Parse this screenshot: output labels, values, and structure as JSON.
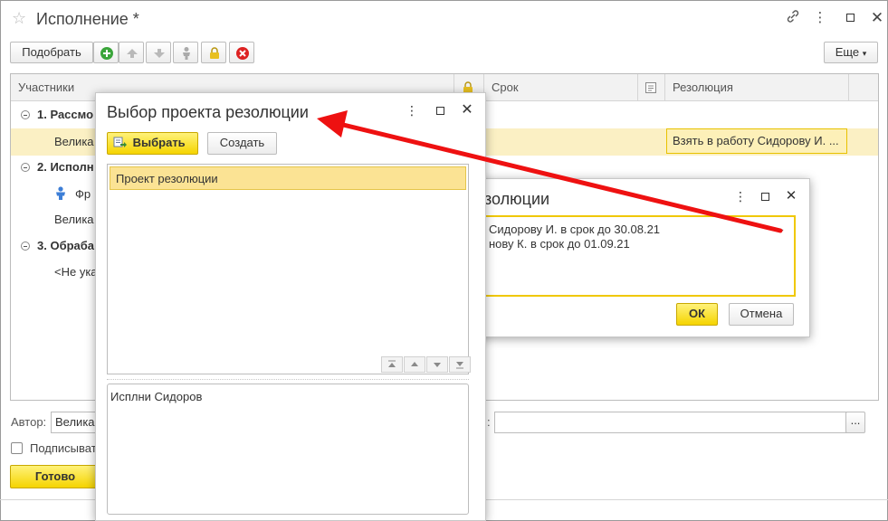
{
  "window": {
    "title": "Исполнение *"
  },
  "toolbar": {
    "pick_label": "Подобрать",
    "more_label": "Еще"
  },
  "grid": {
    "headers": {
      "participants": "Участники",
      "deadline": "Срок",
      "resolution": "Резолюция"
    },
    "rows": {
      "g1": "1. Рассмо",
      "g1_child": "Велика",
      "g1_resolution": "Взять в работу Сидорову И. ...",
      "g2": "2. Исполн",
      "g2_child1": "Фр",
      "g2_child2": "Велика",
      "g3": "3. Обраба",
      "g3_child": "<Не ука"
    }
  },
  "footer": {
    "author_label": "Автор:",
    "author_value": "Велика",
    "right_label": ":",
    "sign_label": "Подписыват",
    "done_label": "Готово"
  },
  "dialog2": {
    "title_partial": "золюции",
    "line1": "Сидорову И. в срок до 30.08.21",
    "line2": "нову К. в срок до 01.09.21",
    "ok_label": "ОК",
    "cancel_label": "Отмена",
    "ellipsis": "..."
  },
  "dialog1": {
    "title": "Выбор проекта резолюции",
    "select_label": "Выбрать",
    "create_label": "Создать",
    "list_items": [
      "Проект резолюции"
    ],
    "text": "Исплни Сидоров"
  },
  "colors": {
    "accent_yellow": "#f5d400",
    "selection": "#fbe394",
    "arrow": "#ee1111"
  }
}
